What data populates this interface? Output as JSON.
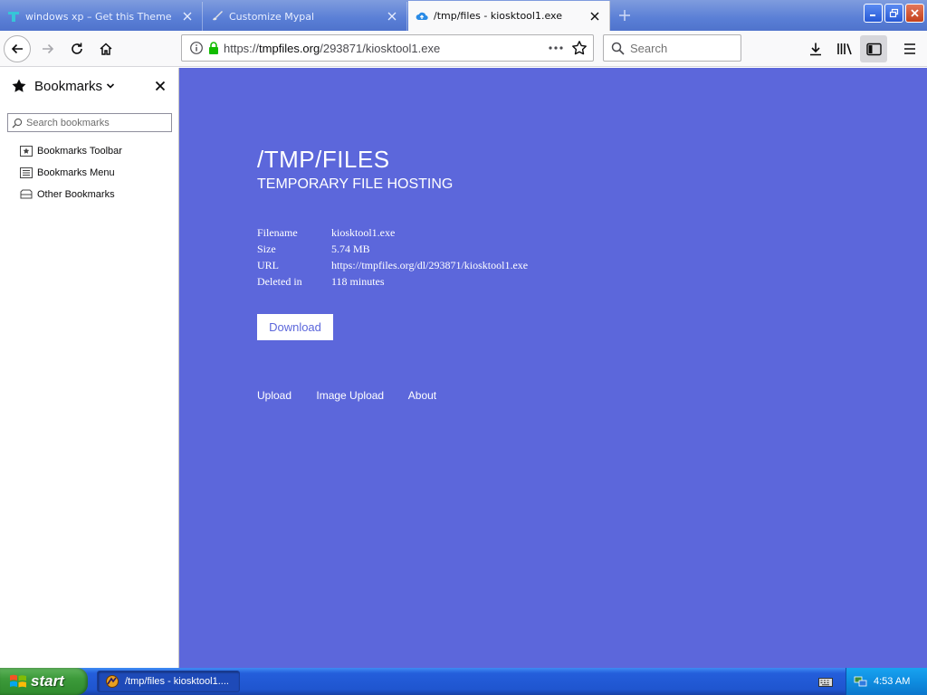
{
  "tabs": [
    {
      "title": "windows xp – Get this Theme for",
      "active": false,
      "favicon": "theme-icon"
    },
    {
      "title": "Customize Mypal",
      "active": false,
      "favicon": "brush-icon"
    },
    {
      "title": "/tmp/files - kiosktool1.exe",
      "active": true,
      "favicon": "cloud-upload-icon"
    }
  ],
  "toolbar": {
    "url_prefix": "https://",
    "url_domain": "tmpfiles.org",
    "url_path": "/293871/kiosktool1.exe",
    "search_placeholder": "Search"
  },
  "sidebar": {
    "title": "Bookmarks",
    "search_placeholder": "Search bookmarks",
    "items": [
      {
        "label": "Bookmarks Toolbar",
        "icon": "bookmarks-toolbar-icon"
      },
      {
        "label": "Bookmarks Menu",
        "icon": "bookmarks-menu-icon"
      },
      {
        "label": "Other Bookmarks",
        "icon": "folder-icon"
      }
    ]
  },
  "page": {
    "title": "/TMP/FILES",
    "subtitle": "TEMPORARY FILE HOSTING",
    "info": [
      {
        "label": "Filename",
        "value": "kiosktool1.exe"
      },
      {
        "label": "Size",
        "value": "5.74 MB"
      },
      {
        "label": "URL",
        "value": "https://tmpfiles.org/dl/293871/kiosktool1.exe"
      },
      {
        "label": "Deleted in",
        "value": "118 minutes"
      }
    ],
    "download_label": "Download",
    "footer_links": [
      "Upload",
      "Image Upload",
      "About"
    ]
  },
  "taskbar": {
    "start_label": "start",
    "task_label": "/tmp/files - kiosktool1....",
    "clock": "4:53 AM"
  },
  "colors": {
    "content_bg": "#5c67db",
    "xp_blue": "#245edb",
    "xp_green": "#3c9a3a"
  }
}
